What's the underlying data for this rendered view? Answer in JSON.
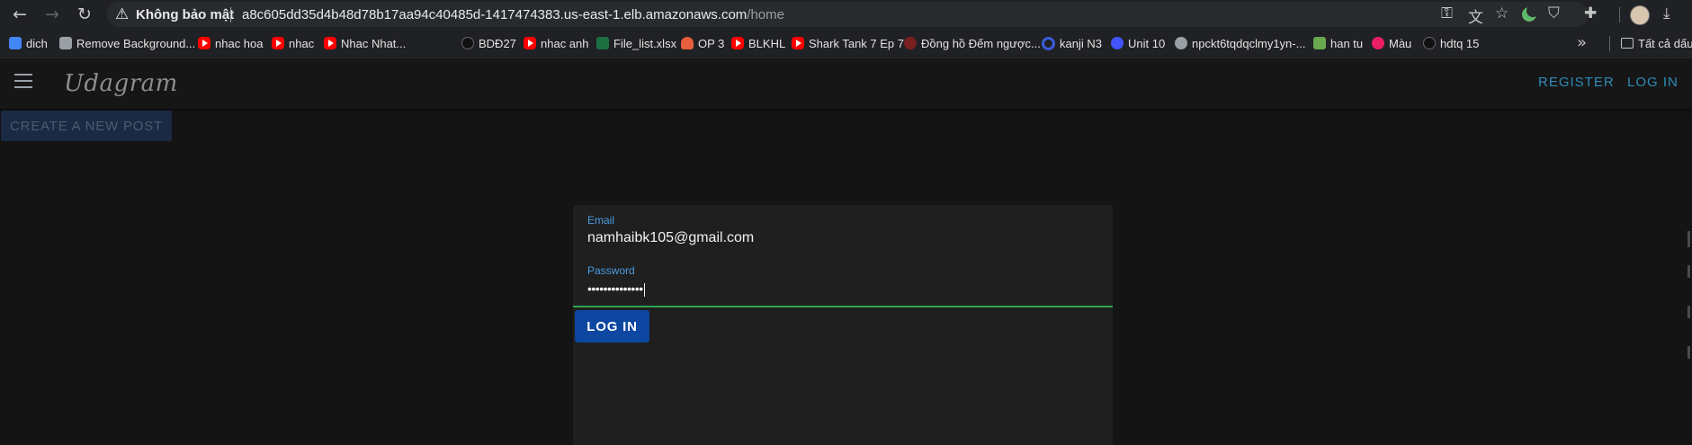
{
  "browser": {
    "security_label": "Không bảo mật",
    "url_host": "a8c605dd35d4b48d78b17aa94c40485d-1417474383.us-east-1.elb.amazonaws.com",
    "url_path": "/home",
    "icons": {
      "back": "arrow-left-icon",
      "forward": "arrow-right-icon",
      "reload": "reload-icon",
      "security": "warning-triangle-icon"
    }
  },
  "bookmarks": [
    {
      "label": "dich",
      "icon": "google-translate-icon",
      "color": "#4285f4"
    },
    {
      "label": "Remove Background...",
      "icon": "layers-icon",
      "color": "#9aa0a6"
    },
    {
      "label": "nhac hoa",
      "icon": "youtube-icon",
      "color": "#ff0000"
    },
    {
      "label": "nhac",
      "icon": "youtube-icon",
      "color": "#ff0000"
    },
    {
      "label": "Nhac Nhat...",
      "icon": "youtube-icon",
      "color": "#ff0000"
    },
    {
      "label": "BDĐ27",
      "icon": "tiktok-icon",
      "color": "#111111"
    },
    {
      "label": "nhac anh",
      "icon": "youtube-icon",
      "color": "#ff0000"
    },
    {
      "label": "File_list.xlsx",
      "icon": "excel-icon",
      "color": "#1d6f42"
    },
    {
      "label": "OP 3",
      "icon": "cloud-icon",
      "color": "#e85d3b"
    },
    {
      "label": "BLKHL",
      "icon": "youtube-icon",
      "color": "#ff0000"
    },
    {
      "label": "Shark Tank 7 Ep 7",
      "icon": "youtube-icon",
      "color": "#ff0000"
    },
    {
      "label": "Đồng hồ Đếm ngược...",
      "icon": "clock-icon",
      "color": "#7a1f1f"
    },
    {
      "label": "kanji N3",
      "icon": "q-icon",
      "color": "#3b5bdb"
    },
    {
      "label": "Unit 10",
      "icon": "quizlet-icon",
      "color": "#4255ff"
    },
    {
      "label": "npckt6tqdqclmy1yn-...",
      "icon": "globe-icon",
      "color": "#9aa0a6"
    },
    {
      "label": "han tu",
      "icon": "image-icon",
      "color": "#6aa84f"
    },
    {
      "label": "Màu",
      "icon": "color-picker-icon",
      "color": "#e91e63"
    },
    {
      "label": "hdtq 15",
      "icon": "tiktok-icon",
      "color": "#111111"
    }
  ],
  "bookmarks_folder": "Tất cả dấu t",
  "app": {
    "brand": "Udagram",
    "register": "Register",
    "login_nav": "Log In",
    "create_post": "Create a New Post",
    "accent_color": "#2f8bb8"
  },
  "login_form": {
    "email_label": "Email",
    "email_value": "namhaibk105@gmail.com",
    "password_label": "Password",
    "password_value": "••••••••••••••",
    "submit_label": "Log In",
    "submit_color": "#0d47a1",
    "focus_color": "#2ea44f"
  }
}
